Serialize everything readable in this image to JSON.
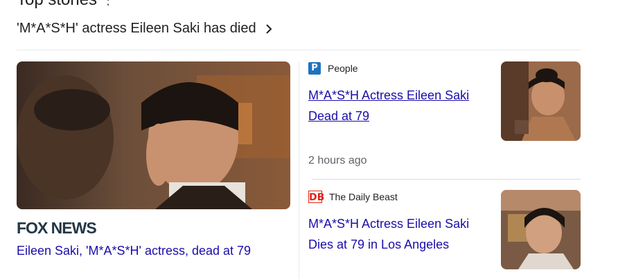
{
  "section": {
    "title": "Top stories",
    "more_symbol": "⋮"
  },
  "headline": {
    "text": "'M*A*S*H' actress Eileen Saki has died"
  },
  "main_story": {
    "publisher": "FOX NEWS",
    "title": "Eileen Saki, 'M*A*S*H' actress, dead at 79"
  },
  "side_stories": [
    {
      "publisher": "People",
      "favicon_letter": "P",
      "title": "M*A*S*H Actress Eileen Saki Dead at 79",
      "timestamp": "2 hours ago"
    },
    {
      "publisher": "The Daily Beast",
      "favicon_letter": "DB",
      "title": "M*A*S*H Actress Eileen Saki Dies at 79 in Los Angeles"
    }
  ],
  "colors": {
    "link": "#1a0dab",
    "text": "#202124",
    "muted": "#5f6368",
    "people_brand": "#1e73be",
    "daily_beast_brand": "#e2231a",
    "fox_brand": "#243746"
  }
}
